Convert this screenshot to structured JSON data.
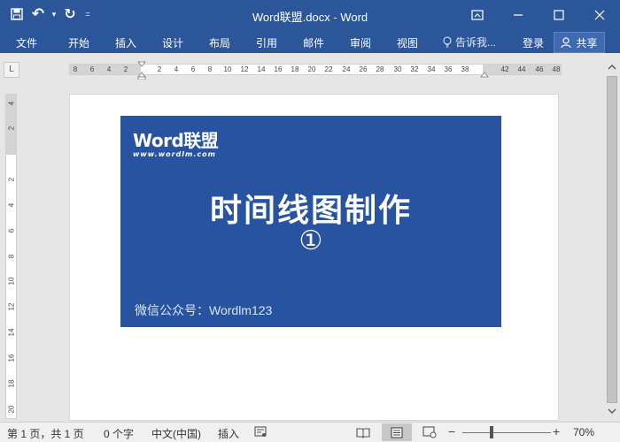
{
  "window": {
    "title": "Word联盟.docx - Word"
  },
  "quick_access": {
    "undo_label": "↶",
    "redo_label": "↻",
    "customize_label": "▾"
  },
  "ribbon": {
    "tabs": [
      {
        "label": "文件"
      },
      {
        "label": "开始"
      },
      {
        "label": "插入"
      },
      {
        "label": "设计"
      },
      {
        "label": "布局"
      },
      {
        "label": "引用"
      },
      {
        "label": "邮件"
      },
      {
        "label": "审阅"
      },
      {
        "label": "视图"
      }
    ],
    "tell_me_placeholder": "告诉我...",
    "login_label": "登录",
    "share_label": "共享"
  },
  "rulers": {
    "corner_label": "L",
    "horizontal": [
      "8",
      "6",
      "4",
      "2",
      "",
      "2",
      "4",
      "6",
      "8",
      "10",
      "12",
      "14",
      "16",
      "18",
      "20",
      "22",
      "24",
      "26",
      "28",
      "30",
      "32",
      "34",
      "36",
      "38",
      "",
      "42",
      "44",
      "46",
      "48"
    ],
    "vertical": [
      "4",
      "2",
      "",
      "2",
      "4",
      "6",
      "8",
      "10",
      "12",
      "14",
      "16",
      "18",
      "20"
    ]
  },
  "document": {
    "banner": {
      "logo_word": "Word联盟",
      "logo_url": "www.wordlm.com",
      "title": "时间线图制作",
      "number": "①",
      "footer": "微信公众号：Wordlm123"
    }
  },
  "statusbar": {
    "page_info": "第 1 页，共 1 页",
    "word_count": "0 个字",
    "language": "中文(中国)",
    "insert_mode": "插入",
    "zoom_level": "70%",
    "zoom_minus": "−",
    "zoom_plus": "+"
  },
  "colors": {
    "accent": "#2b579a",
    "banner": "#2753a1"
  }
}
